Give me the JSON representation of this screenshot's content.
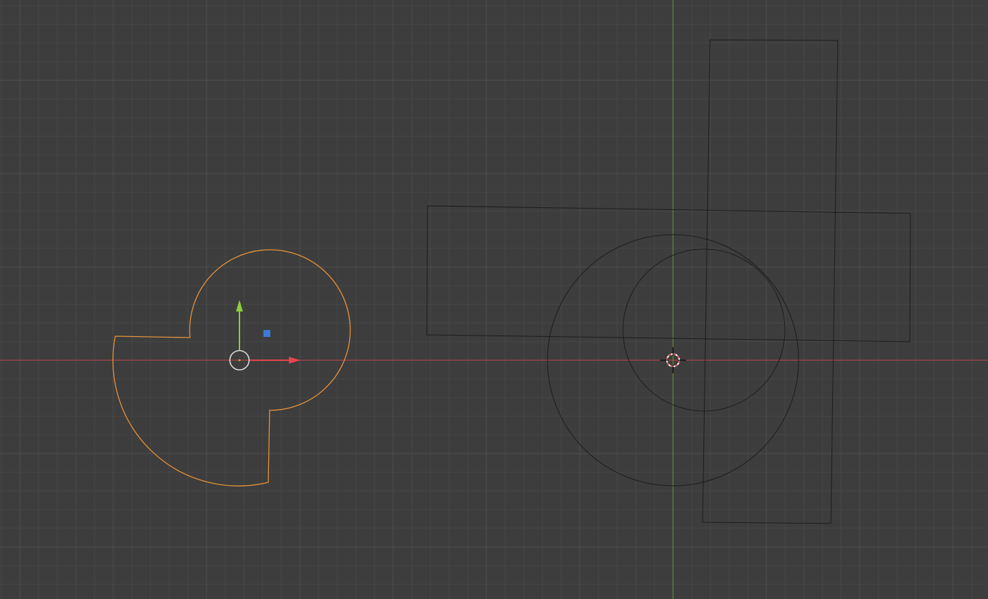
{
  "viewport": {
    "name": "3d-viewport",
    "view": "top-orthographic"
  },
  "colors": {
    "background": "#3d3d3d",
    "grid_minor": "#474747",
    "grid_major": "#4f4f4f",
    "x_axis": "#c9434f",
    "y_axis": "#6e9a2c",
    "selected_outline": "#e8943a",
    "unselected_outline": "#1c1c1c",
    "gizmo_x": "#e8434f",
    "gizmo_y": "#8ccf3a",
    "gizmo_z": "#3c7ad6",
    "pivot_circle": "#dedede",
    "cursor_red": "#e05050",
    "cursor_white": "#ffffff",
    "cursor_black": "#000000"
  },
  "objects": [
    {
      "name": "selected-curve-object",
      "state": "selected",
      "shape": "circle-with-notches"
    },
    {
      "name": "rectangle-horizontal",
      "state": "unselected",
      "shape": "rectangle"
    },
    {
      "name": "rectangle-vertical",
      "state": "unselected",
      "shape": "rectangle"
    },
    {
      "name": "circle-large",
      "state": "unselected",
      "shape": "circle"
    },
    {
      "name": "circle-small",
      "state": "unselected",
      "shape": "circle"
    }
  ],
  "gizmo": {
    "icons": [
      "move-x-arrow-icon",
      "move-y-arrow-icon",
      "move-z-plane-icon",
      "pivot-circle-icon"
    ]
  },
  "cursor": {
    "icon": "3d-cursor-icon"
  }
}
